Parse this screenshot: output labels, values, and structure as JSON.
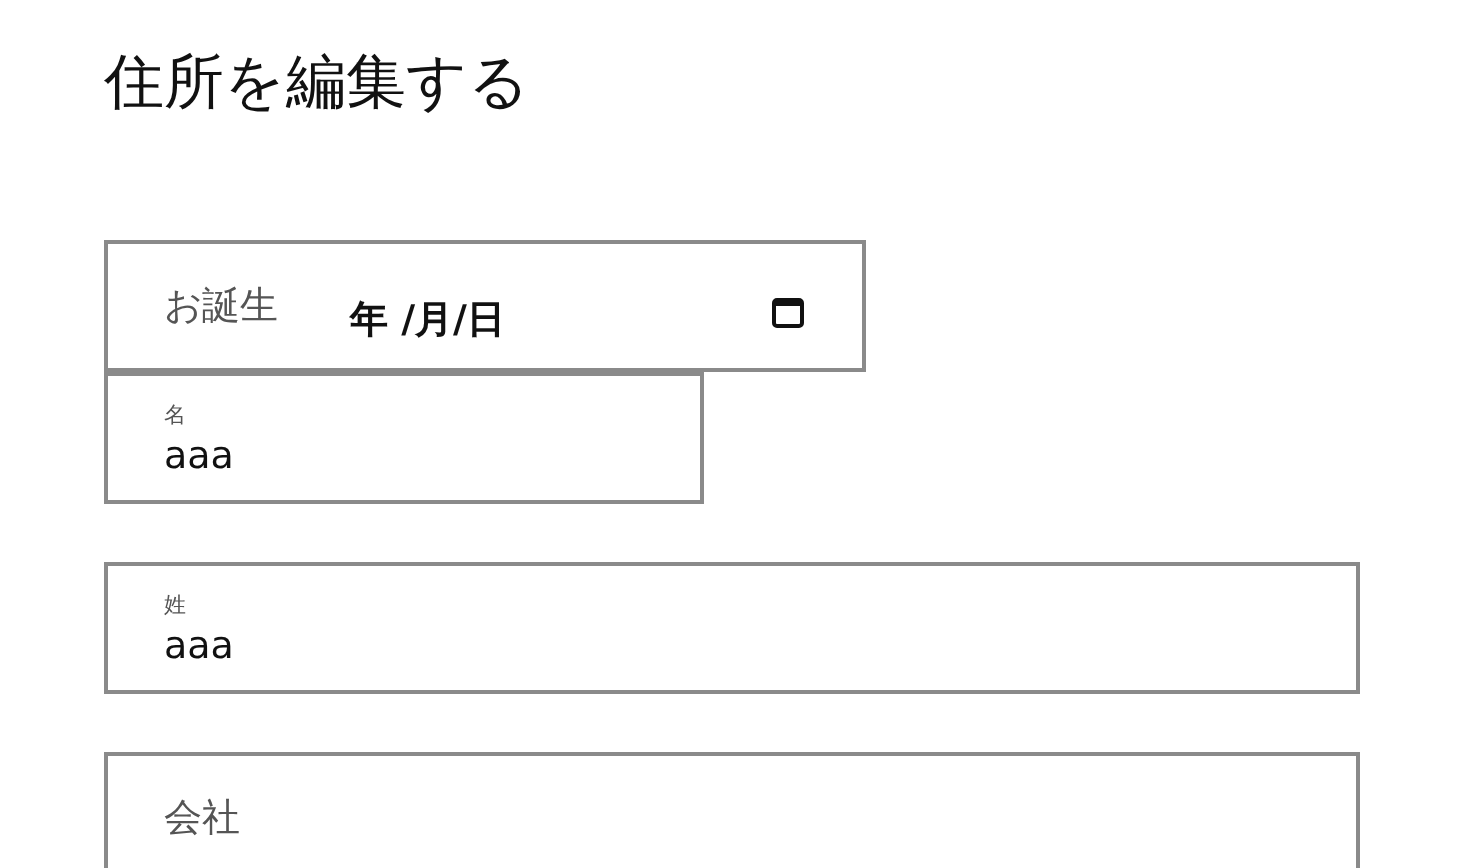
{
  "title": "住所を編集する",
  "fields": [
    {
      "kind": "date",
      "label": "お誕生",
      "placeholder": "年 /月/日"
    },
    {
      "kind": "text",
      "label": "名",
      "value": "aaa"
    },
    {
      "kind": "text",
      "label": "姓",
      "value": "aaa"
    },
    {
      "kind": "empty",
      "label": "会社"
    }
  ]
}
